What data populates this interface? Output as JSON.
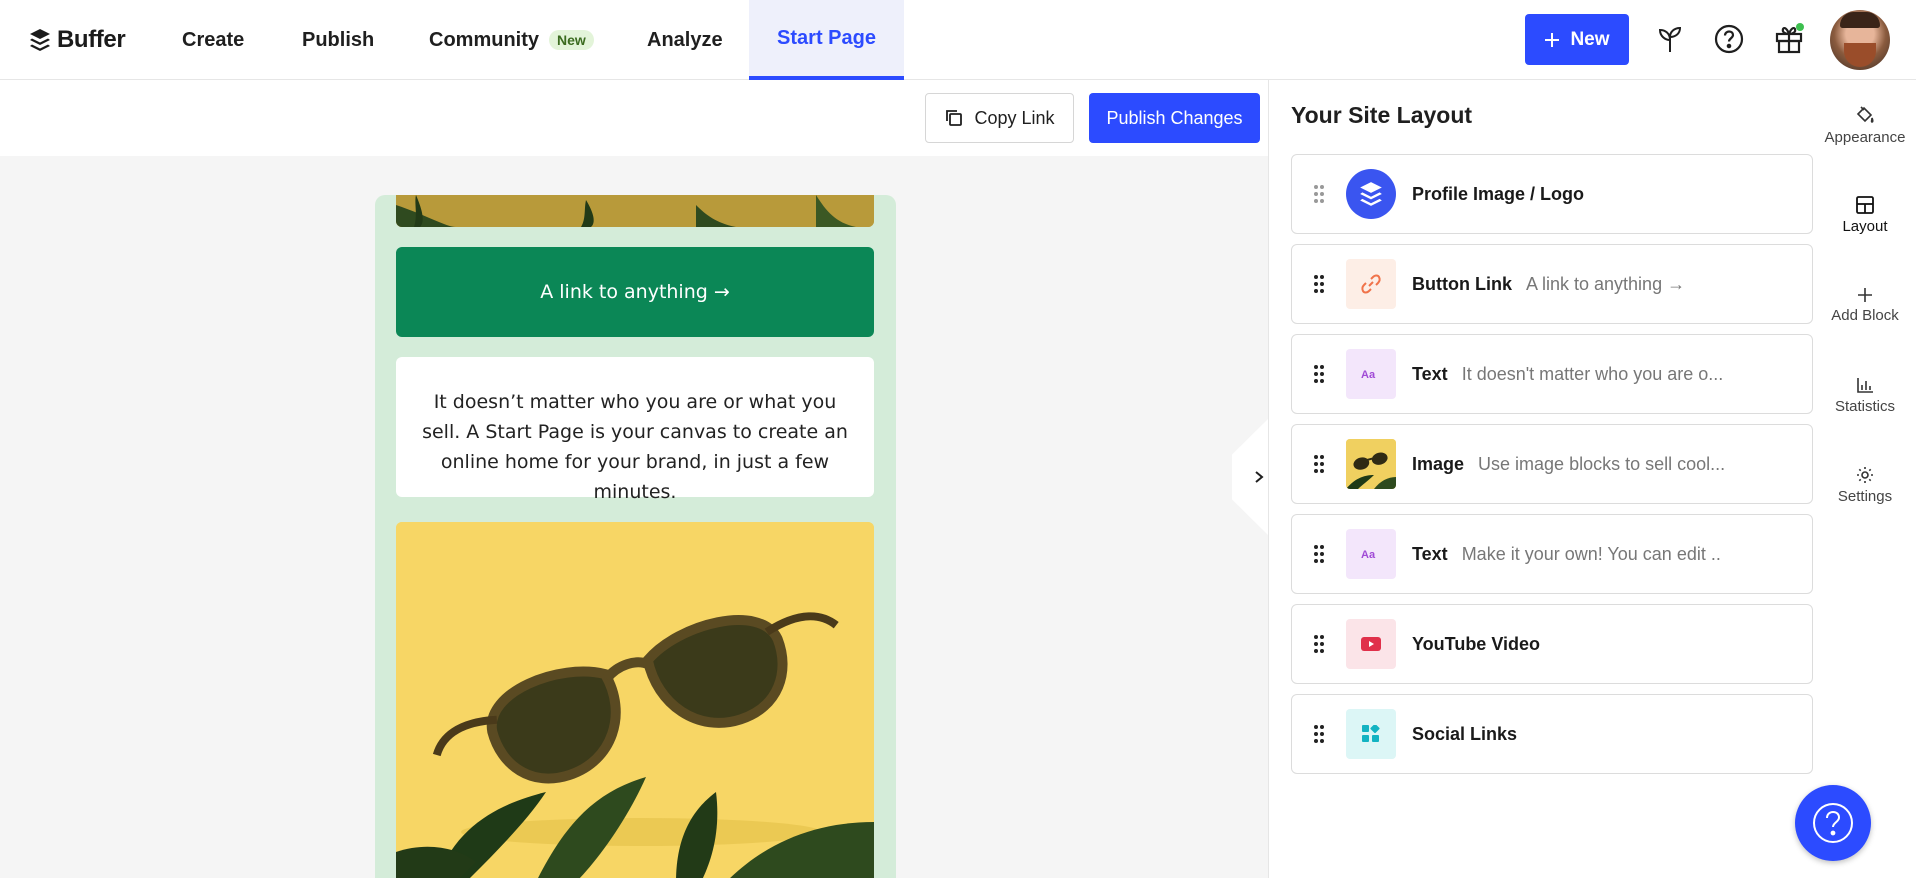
{
  "nav": {
    "brand": "Buffer",
    "items": [
      {
        "label": "Create"
      },
      {
        "label": "Publish"
      },
      {
        "label": "Community",
        "badge": "New"
      },
      {
        "label": "Analyze"
      },
      {
        "label": "Start Page"
      }
    ],
    "new_button": "New"
  },
  "toolbar": {
    "copy_link": "Copy Link",
    "publish_changes": "Publish Changes"
  },
  "preview": {
    "link_text": "A link to anything →",
    "text_block": "It doesn’t matter who you are or what you sell. A Start Page is your canvas to create an online home for your brand, in just a few minutes."
  },
  "panel": {
    "title": "Your Site Layout",
    "blocks": [
      {
        "title": "Profile Image / Logo",
        "subtitle": "",
        "icon": "buffer-logo-icon"
      },
      {
        "title": "Button Link",
        "subtitle": "A link to anything →",
        "icon": "link-icon"
      },
      {
        "title": "Text",
        "subtitle": "It doesn't matter who you are o...",
        "icon": "text-icon"
      },
      {
        "title": "Image",
        "subtitle": "Use image blocks to sell cool...",
        "icon": "image-thumbnail"
      },
      {
        "title": "Text",
        "subtitle": "Make it your own! You can edit ...",
        "icon": "text-icon"
      },
      {
        "title": "YouTube Video",
        "subtitle": "",
        "icon": "youtube-icon"
      },
      {
        "title": "Social Links",
        "subtitle": "",
        "icon": "social-grid-icon"
      }
    ]
  },
  "rail": {
    "items": [
      {
        "label": "Appearance"
      },
      {
        "label": "Layout"
      },
      {
        "label": "Add Block"
      },
      {
        "label": "Statistics"
      },
      {
        "label": "Settings"
      }
    ]
  },
  "colors": {
    "accent": "#2c4bff",
    "link_block": "#0b8756",
    "preview_bg": "#d4ecd9",
    "image_bg": "#f7d665"
  }
}
